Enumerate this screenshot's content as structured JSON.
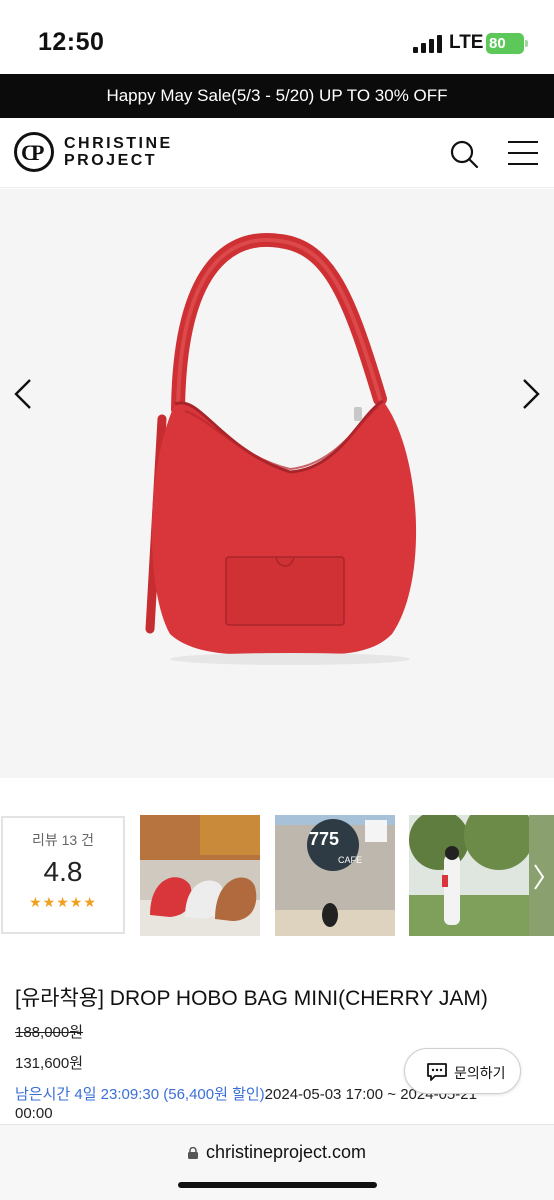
{
  "status_bar": {
    "time": "12:50",
    "network": "LTE",
    "battery": "80"
  },
  "promo": {
    "text": "Happy May Sale(5/3 - 5/20) UP TO 30% OFF"
  },
  "header": {
    "logo_line1": "CHRISTINE",
    "logo_line2": "PROJECT",
    "icons": [
      "search-icon",
      "hamburger-menu-icon"
    ]
  },
  "gallery": {
    "icons": [
      "chevron-left-icon",
      "chevron-right-icon"
    ],
    "thumbnails": [
      {
        "cafe_label": "775",
        "cafe_sub": "CAFE"
      }
    ]
  },
  "reviews": {
    "count_label": "리뷰 13 건",
    "score": "4.8",
    "stars": "★★★★★"
  },
  "product": {
    "title": "[유라착용] DROP HOBO BAG MINI(CHERRY JAM)",
    "original_price": "188,000원",
    "sale_price": "131,600원",
    "timer_label": "남은시간 4일 23:09:30 (56,400원 할인)",
    "timer_dates": "2024-05-03 17:00 ~ 2024-05-21",
    "timer_end": "00:00"
  },
  "inquiry_button": {
    "label": "문의하기"
  },
  "browser": {
    "url": "christineproject.com"
  },
  "colors": {
    "bag": "#d8363a",
    "promo_bg": "#0b0b0b",
    "timer": "#3a6fd8",
    "star": "#f0a01e"
  }
}
